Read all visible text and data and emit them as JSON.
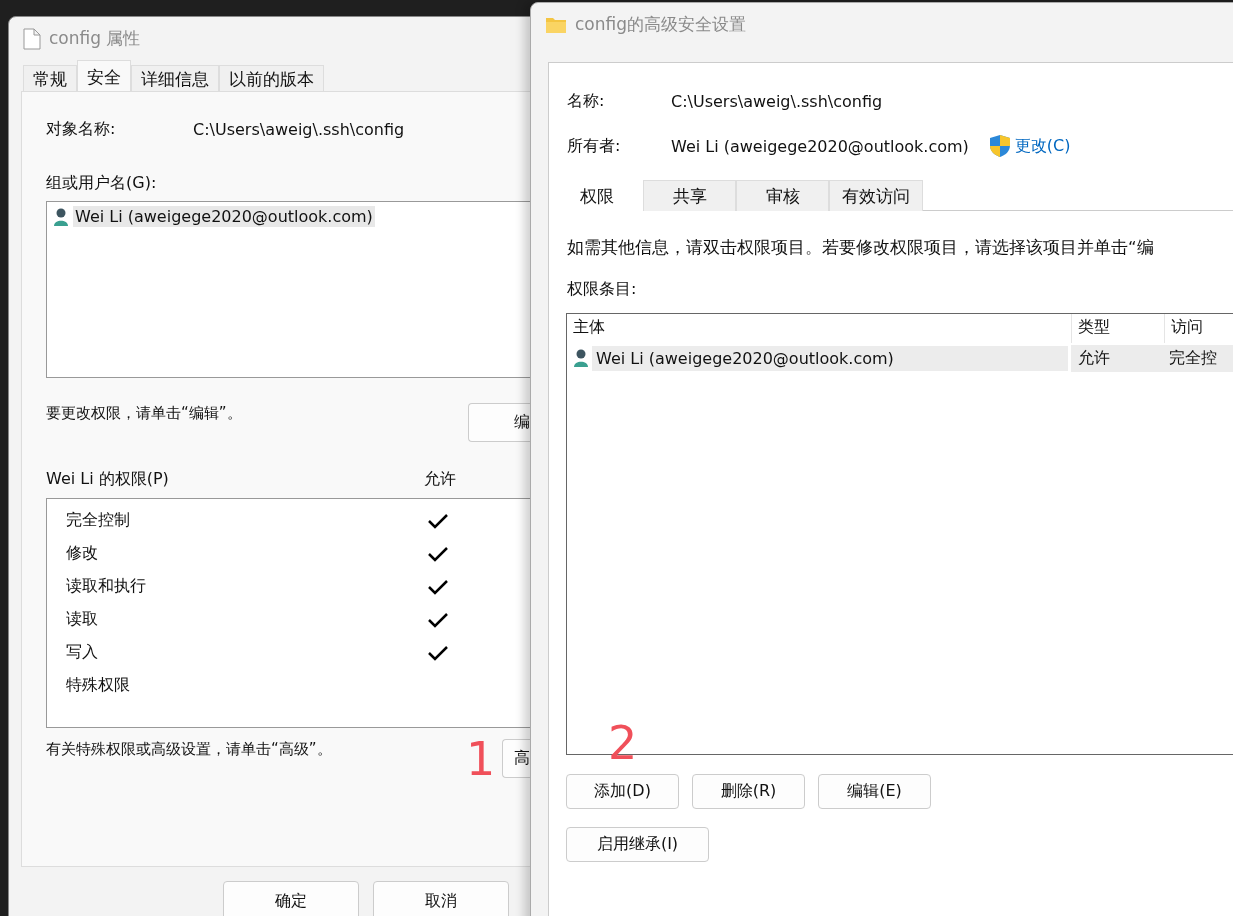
{
  "property_window": {
    "title": "config 属性",
    "tabs": [
      {
        "label": "常规",
        "selected": false
      },
      {
        "label": "安全",
        "selected": true
      },
      {
        "label": "详细信息",
        "selected": false
      },
      {
        "label": "以前的版本",
        "selected": false
      }
    ],
    "object_name_label": "对象名称:",
    "object_name": "C:\\Users\\aweig\\.ssh\\config",
    "groups_label": "组或用户名(G):",
    "users": [
      {
        "name": "Wei Li (aweigege2020@outlook.com)",
        "selected": true
      }
    ],
    "edit_hint": "要更改权限，请单击“编辑”。",
    "edit_button": "编",
    "permissions_label": "Wei Li 的权限(P)",
    "allow_header": "允许",
    "permissions": [
      {
        "name": "完全控制",
        "allow": true
      },
      {
        "name": "修改",
        "allow": true
      },
      {
        "name": "读取和执行",
        "allow": true
      },
      {
        "name": "读取",
        "allow": true
      },
      {
        "name": "写入",
        "allow": true
      },
      {
        "name": "特殊权限",
        "allow": false
      }
    ],
    "advanced_hint": "有关特殊权限或高级设置，请单击“高级”。",
    "advanced_button": "高",
    "buttons": [
      "确定",
      "取消"
    ]
  },
  "advanced_window": {
    "title": "config的高级安全设置",
    "name_label": "名称:",
    "name": "C:\\Users\\aweig\\.ssh\\config",
    "owner_label": "所有者:",
    "owner": "Wei Li (aweigege2020@outlook.com)",
    "change_link": "更改(C)",
    "tabs": [
      {
        "label": "权限",
        "selected": true
      },
      {
        "label": "共享",
        "selected": false
      },
      {
        "label": "审核",
        "selected": false
      },
      {
        "label": "有效访问",
        "selected": false
      }
    ],
    "info": "如需其他信息，请双击权限项目。若要修改权限项目，请选择该项目并单击“编",
    "entries_label": "权限条目:",
    "table": {
      "columns": [
        "主体",
        "类型",
        "访问"
      ],
      "rows": [
        {
          "principal": "Wei Li (aweigege2020@outlook.com)",
          "type": "允许",
          "access": "完全控",
          "selected": true
        }
      ]
    },
    "buttons": [
      "添加(D)",
      "删除(R)",
      "编辑(E)"
    ],
    "inherit_button": "启用继承(I)"
  },
  "annotations": [
    {
      "text": "1"
    },
    {
      "text": "2"
    }
  ]
}
